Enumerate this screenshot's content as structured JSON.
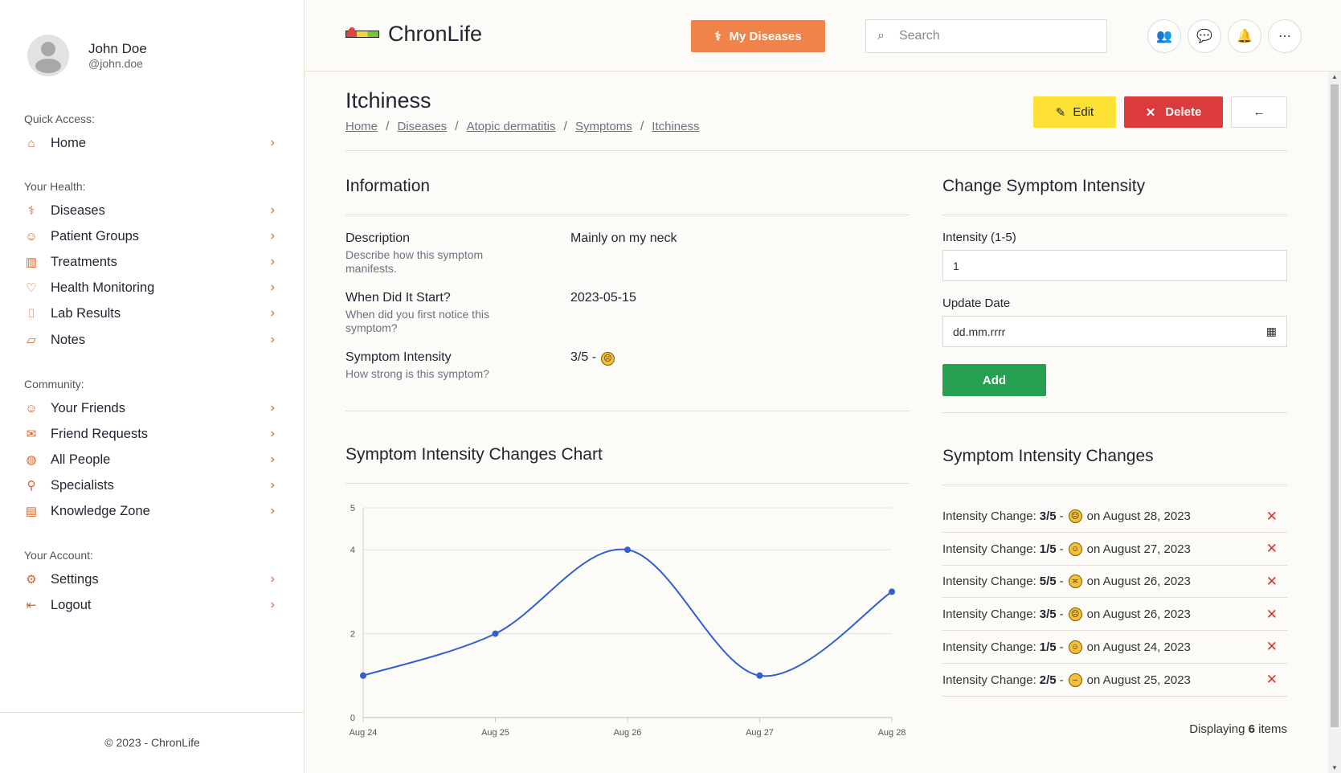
{
  "user": {
    "name": "John Doe",
    "handle": "@john.doe"
  },
  "sidebar": {
    "sections": [
      {
        "title": "Quick Access:",
        "items": [
          {
            "label": "Home",
            "icon": "home-icon"
          }
        ]
      },
      {
        "title": "Your Health:",
        "items": [
          {
            "label": "Diseases",
            "icon": "stethoscope-icon"
          },
          {
            "label": "Patient Groups",
            "icon": "users-icon"
          },
          {
            "label": "Treatments",
            "icon": "hospital-icon"
          },
          {
            "label": "Health Monitoring",
            "icon": "heart-pulse-icon"
          },
          {
            "label": "Lab Results",
            "icon": "test-tube-icon"
          },
          {
            "label": "Notes",
            "icon": "note-icon"
          }
        ]
      },
      {
        "title": "Community:",
        "items": [
          {
            "label": "Your Friends",
            "icon": "user-friends-icon"
          },
          {
            "label": "Friend Requests",
            "icon": "inbox-icon"
          },
          {
            "label": "All People",
            "icon": "globe-icon"
          },
          {
            "label": "Specialists",
            "icon": "doctor-icon"
          },
          {
            "label": "Knowledge Zone",
            "icon": "book-icon"
          }
        ]
      },
      {
        "title": "Your Account:",
        "items": [
          {
            "label": "Settings",
            "icon": "gear-icon"
          },
          {
            "label": "Logout",
            "icon": "logout-icon"
          }
        ]
      }
    ],
    "footer": "© 2023 - ChronLife"
  },
  "header": {
    "brand": "ChronLife",
    "my_diseases": "My Diseases",
    "search_placeholder": "Search"
  },
  "page": {
    "title": "Itchiness",
    "breadcrumb": [
      "Home",
      "Diseases",
      "Atopic dermatitis",
      "Symptoms",
      "Itchiness"
    ],
    "edit": "Edit",
    "delete": "Delete",
    "info_title": "Information",
    "info": [
      {
        "label": "Description",
        "hint": "Describe how this symptom manifests.",
        "value": "Mainly on my neck"
      },
      {
        "label": "When Did It Start?",
        "hint": "When did you first notice this symptom?",
        "value": "2023-05-15"
      },
      {
        "label": "Symptom Intensity",
        "hint": "How strong is this symptom?",
        "value": "3/5 -"
      }
    ],
    "chart_title": "Symptom Intensity Changes Chart",
    "form": {
      "title": "Change Symptom Intensity",
      "intensity_label": "Intensity (1-5)",
      "intensity_value": "1",
      "date_label": "Update Date",
      "date_placeholder": "dd.mm.rrrr",
      "add": "Add"
    },
    "changes_title": "Symptom Intensity Changes",
    "changes_prefix": "Intensity Change:",
    "changes": [
      {
        "value": "3/5",
        "date": "on August 28, 2023",
        "face": "frown"
      },
      {
        "value": "1/5",
        "date": "on August 27, 2023",
        "face": "smile"
      },
      {
        "value": "5/5",
        "date": "on August 26, 2023",
        "face": "tired"
      },
      {
        "value": "3/5",
        "date": "on August 26, 2023",
        "face": "frown"
      },
      {
        "value": "1/5",
        "date": "on August 24, 2023",
        "face": "smile"
      },
      {
        "value": "2/5",
        "date": "on August 25, 2023",
        "face": "neutral"
      }
    ],
    "displaying_prefix": "Displaying",
    "displaying_count": "6",
    "displaying_suffix": "items"
  },
  "colors": {
    "accent": "#f0834a",
    "edit": "#fde135",
    "delete": "#dc3b3b",
    "add": "#25a051",
    "line": "#2f5fd0"
  },
  "chart_data": {
    "type": "line",
    "categories": [
      "Aug 24",
      "Aug 25",
      "Aug 26",
      "Aug 27",
      "Aug 28"
    ],
    "values": [
      1,
      2,
      4,
      1,
      3
    ],
    "yticks": [
      0,
      2,
      4,
      5
    ],
    "ylim": [
      0,
      5
    ],
    "grid": true
  }
}
